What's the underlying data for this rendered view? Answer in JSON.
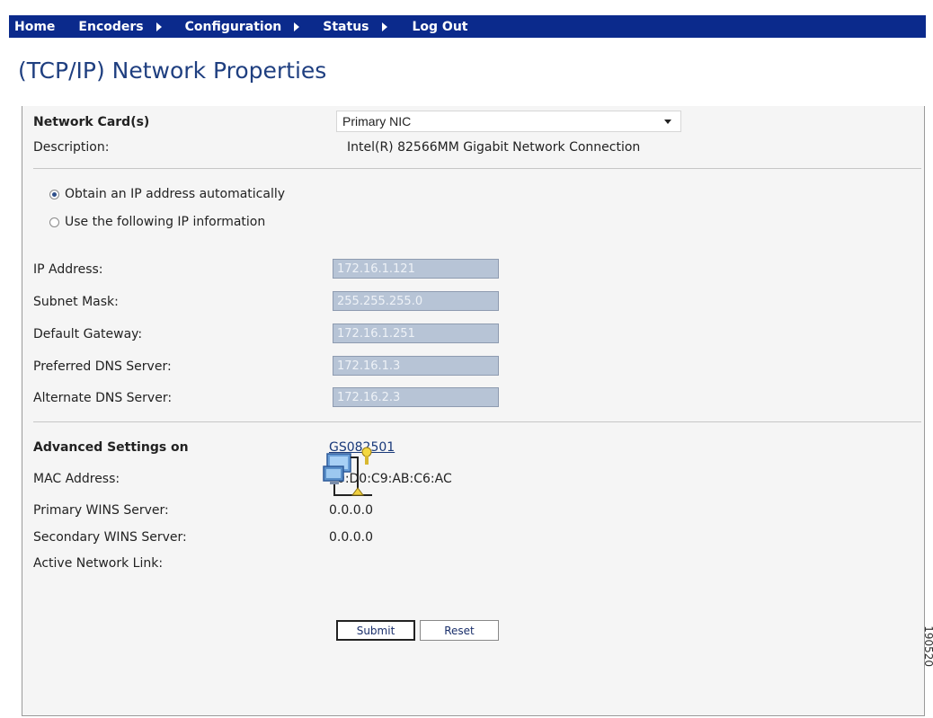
{
  "nav": {
    "items": [
      {
        "label": "Home",
        "has_arrow": false
      },
      {
        "label": "Encoders",
        "has_arrow": true
      },
      {
        "label": "Configuration",
        "has_arrow": true
      },
      {
        "label": "Status",
        "has_arrow": true
      },
      {
        "label": "Log Out",
        "has_arrow": false
      }
    ]
  },
  "page": {
    "title": "(TCP/IP) Network Properties"
  },
  "network_card": {
    "label": "Network Card(s)",
    "selected": "Primary NIC",
    "description_label": "Description:",
    "description_value": "Intel(R) 82566MM Gigabit Network Connection"
  },
  "ip_mode": {
    "auto_label": "Obtain an IP address automatically",
    "manual_label": "Use the following IP information",
    "selected": "auto"
  },
  "ip_fields": [
    {
      "label": "IP Address:",
      "value": "172.16.1.121"
    },
    {
      "label": "Subnet Mask:",
      "value": "255.255.255.0"
    },
    {
      "label": "Default Gateway:",
      "value": "172.16.1.251"
    },
    {
      "label": "Preferred DNS Server:",
      "value": "172.16.1.3"
    },
    {
      "label": "Alternate DNS Server:",
      "value": "172.16.2.3"
    }
  ],
  "advanced": {
    "label": "Advanced Settings on",
    "host_link": "GS082501",
    "mac_label": "MAC Address:",
    "mac_value": "00:D0:C9:AB:C6:AC",
    "primary_wins_label": "Primary WINS Server:",
    "primary_wins_value": "0.0.0.0",
    "secondary_wins_label": "Secondary WINS Server:",
    "secondary_wins_value": "0.0.0.0",
    "active_link_label": "Active Network Link:",
    "active_link_icon": "network-connection-icon"
  },
  "buttons": {
    "submit": "Submit",
    "reset": "Reset"
  },
  "figure_code": "190520",
  "colors": {
    "nav_bg": "#0b2a8c",
    "title": "#1f3f80",
    "field_bg": "#b7c4d6",
    "panel_bg": "#f5f5f5"
  }
}
